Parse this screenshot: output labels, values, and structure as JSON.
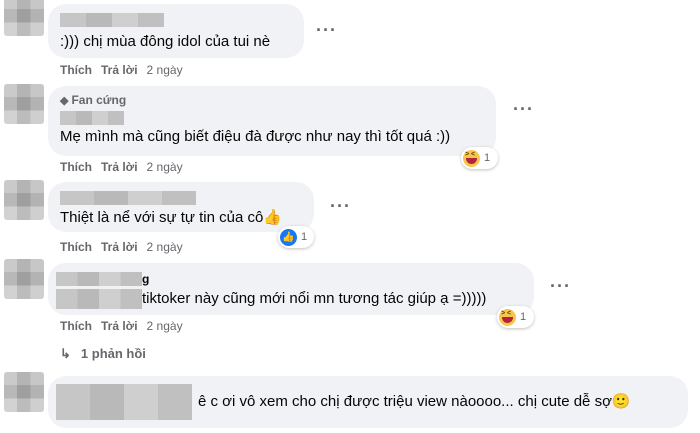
{
  "comments": [
    {
      "text": ":))) chị mùa đông idol của tui nè",
      "actions": {
        "like": "Thích",
        "reply": "Trả lời",
        "time": "2 ngày"
      }
    },
    {
      "badge": "Fan cứng",
      "text": "Mẹ mình mà cũng biết điệu đà được như nay thì tốt quá :))",
      "reaction_count": "1",
      "reaction_icon": "haha-emoji-icon",
      "actions": {
        "like": "Thích",
        "reply": "Trả lời",
        "time": "2 ngày"
      }
    },
    {
      "text": "Thiệt là nể với sự tự tin của cô👍",
      "reaction_count": "1",
      "reaction_icon": "like-reaction-icon",
      "actions": {
        "like": "Thích",
        "reply": "Trả lời",
        "time": "2 ngày"
      }
    },
    {
      "name_visible": "g",
      "text": "tiktoker này cũng mới nổi mn tương tác giúp ạ =)))))",
      "reaction_count": "1",
      "reaction_icon": "haha-emoji-icon",
      "actions": {
        "like": "Thích",
        "reply": "Trả lời",
        "time": "2 ngày"
      }
    },
    {
      "text": "ê c ơi vô xem cho chị được triệu view nàoooo... chị cute dễ sợ🙂"
    }
  ],
  "replies_link": "1 phản hồi",
  "more_icon": "···"
}
